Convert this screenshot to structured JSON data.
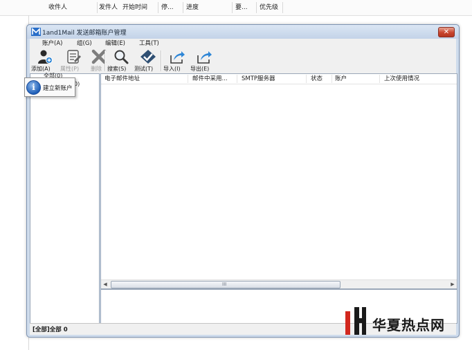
{
  "background_list": {
    "columns": [
      "收件人",
      "发件人",
      "开始时间",
      "停...",
      "进度",
      "要...",
      "优先级"
    ]
  },
  "window": {
    "title": "1and1Mail 发送邮箱账户管理",
    "close_icon": "close-icon",
    "menu": [
      "账户(A)",
      "组(G)",
      "编辑(E)",
      "工具(T)"
    ],
    "toolbar": [
      {
        "label": "添加(A)",
        "icon": "add-user-icon",
        "enabled": true
      },
      {
        "label": "属性(P)",
        "icon": "properties-icon",
        "enabled": false
      },
      {
        "label": "删除",
        "icon": "delete-icon",
        "enabled": false
      },
      {
        "label": "搜索(S)",
        "icon": "search-icon",
        "enabled": true
      },
      {
        "label": "测试(T)",
        "icon": "test-icon",
        "enabled": true
      },
      {
        "label": "导入(I)",
        "icon": "import-icon",
        "enabled": true
      },
      {
        "label": "导出(E)",
        "icon": "export-icon",
        "enabled": true
      }
    ],
    "tree": {
      "fragment_top": "全部(0)",
      "fragment_side": "0)"
    },
    "list_columns": [
      "电子邮件地址",
      "邮件中采用...",
      "SMTP服务器",
      "状态",
      "账户",
      "上次使用情况"
    ],
    "scroll_grip": "III",
    "status": "[全部]全部 0",
    "popup": {
      "icon": "info-icon",
      "icon_glyph": "i",
      "label": "建立新账户"
    }
  },
  "watermark": {
    "text": "华夏热点网"
  },
  "colors": {
    "accent": "#1f5fb7",
    "close": "#c9452e",
    "frame": "#cfdcec"
  }
}
